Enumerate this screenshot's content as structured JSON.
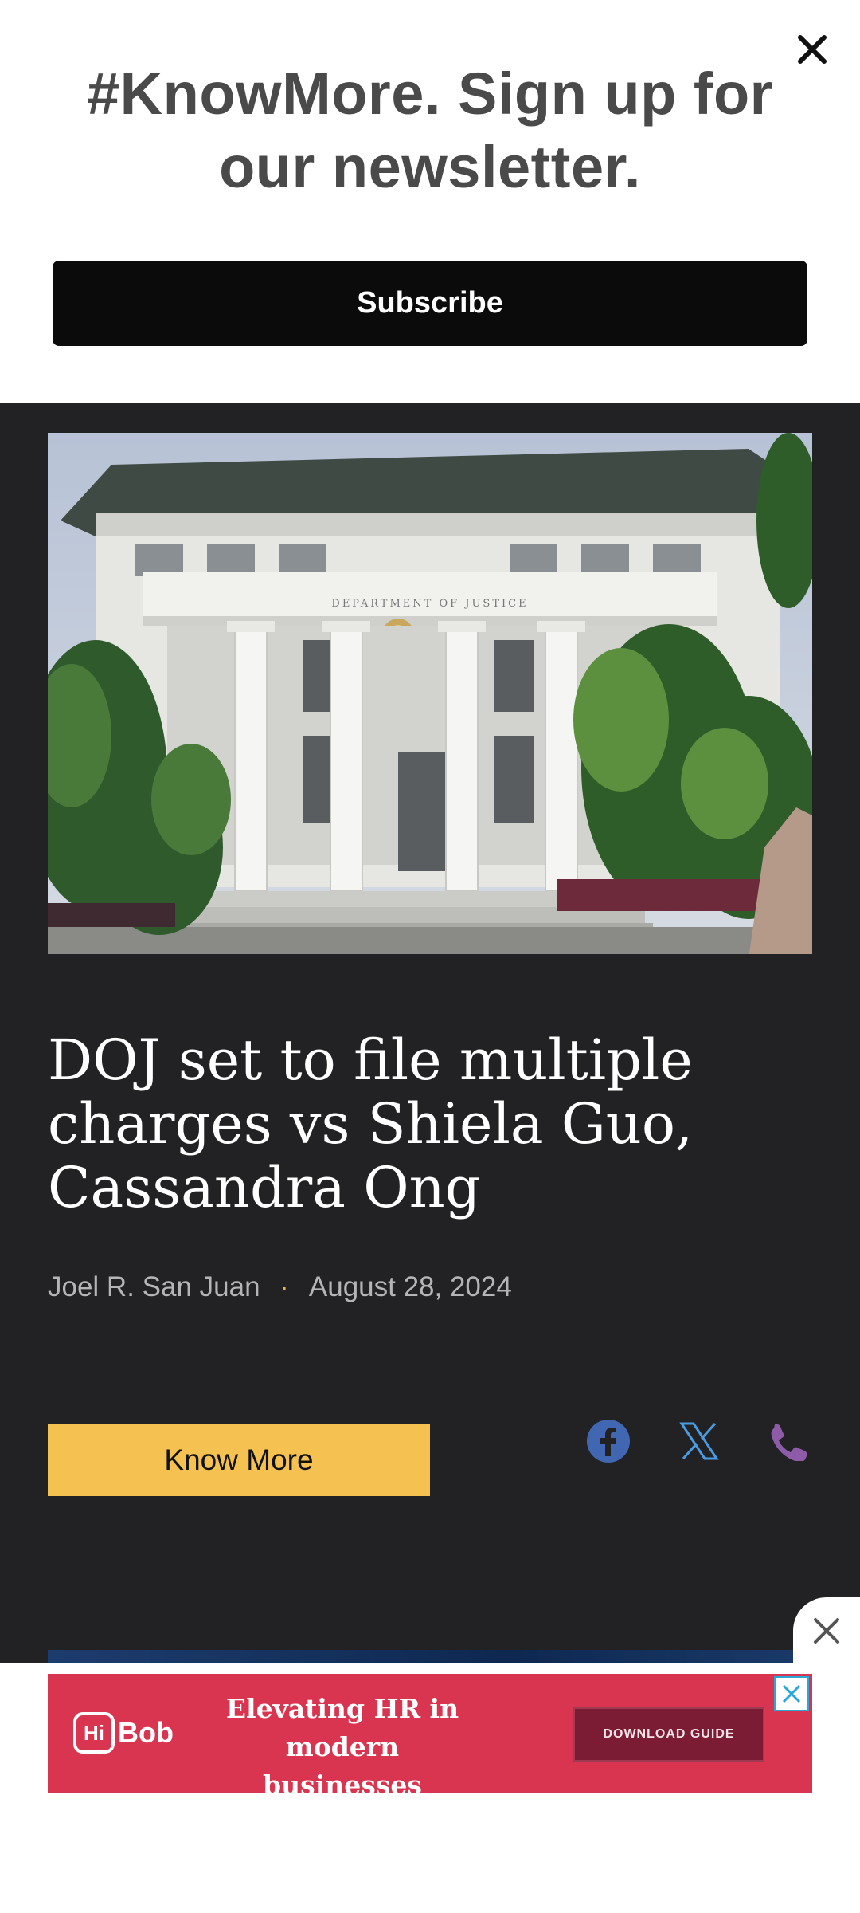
{
  "newsletter": {
    "title": "#KnowMore. Sign up for our newsletter.",
    "subscribe_label": "Subscribe",
    "close_icon": "close-icon"
  },
  "article": {
    "image_subject": "Department of Justice building facade with columns",
    "image_sign_text": "DEPARTMENT OF JUSTICE",
    "title": "DOJ set to file multiple charges vs Shiela Guo, Cassandra Ong",
    "author": "Joel R. San Juan",
    "separator": "·",
    "date": "August 28, 2024",
    "know_more_label": "Know More"
  },
  "share": {
    "icons": [
      "facebook-icon",
      "x-twitter-icon",
      "phone-icon"
    ],
    "colors": {
      "facebook": "#4267B2",
      "x": "#4A9BE0",
      "phone": "#8E5BA8"
    }
  },
  "ad": {
    "brand_hi": "Hi",
    "brand_bob": "Bob",
    "headline": "Elevating HR in modern businesses",
    "cta": "DOWNLOAD GUIDE",
    "background": "#D93550"
  },
  "colors": {
    "page_background": "#222224",
    "accent_button": "#F5C151",
    "byline_dot": "#E8B548"
  }
}
